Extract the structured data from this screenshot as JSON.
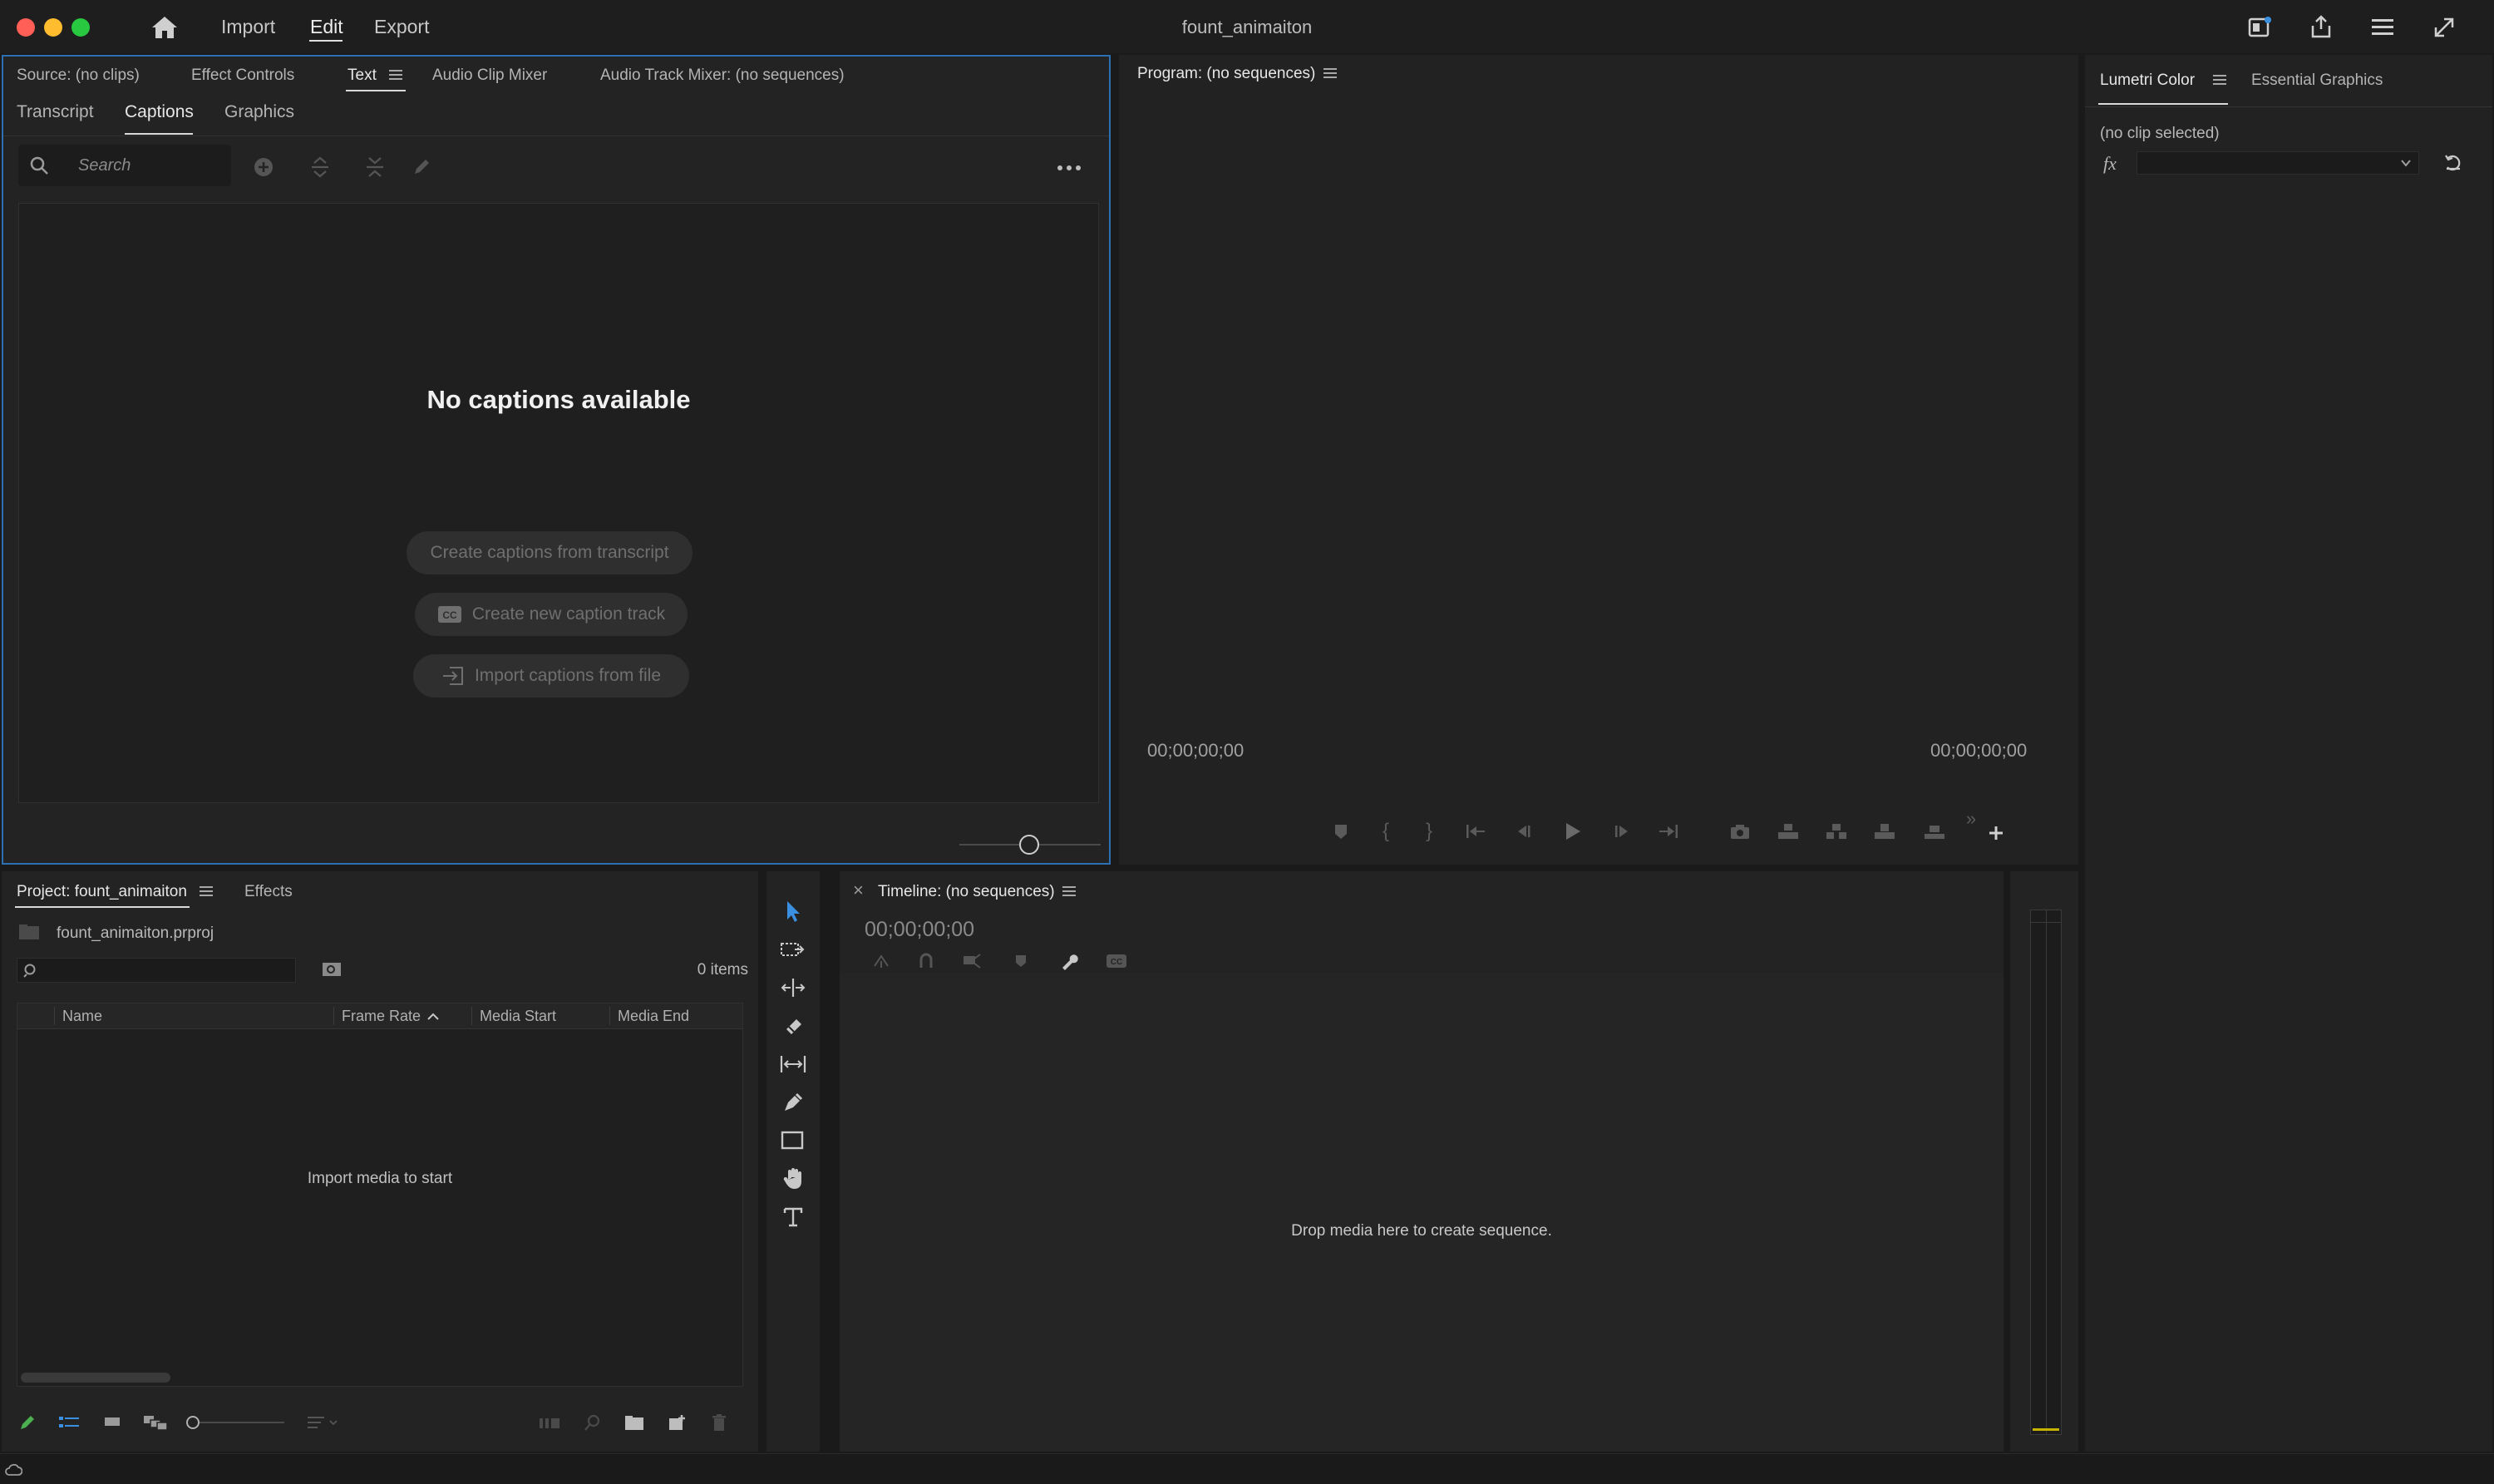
{
  "titlebar": {
    "title": "fount_animaiton",
    "nav": [
      "Import",
      "Edit",
      "Export"
    ],
    "active_nav": "Edit",
    "icons": [
      "home-icon",
      "quick-export-icon",
      "share-icon",
      "workspaces-icon",
      "fullscreen-icon"
    ]
  },
  "text_panel": {
    "top_tabs": [
      "Source: (no clips)",
      "Effect Controls",
      "Text",
      "Audio Clip Mixer",
      "Audio Track Mixer: (no sequences)"
    ],
    "active_top_tab": "Text",
    "sub_tabs": [
      "Transcript",
      "Captions",
      "Graphics"
    ],
    "active_sub_tab": "Captions",
    "search_placeholder": "Search",
    "empty_title": "No captions available",
    "buttons": [
      "Create captions from transcript",
      "Create new caption track",
      "Import captions from file"
    ]
  },
  "program_monitor": {
    "title": "Program: (no sequences)",
    "timecode_left": "00;00;00;00",
    "timecode_right": "00;00;00;00",
    "controls": [
      "add-marker-icon",
      "mark-in-icon",
      "mark-out-icon",
      "go-to-in-icon",
      "step-back-icon",
      "play-icon",
      "step-forward-icon",
      "go-to-out-icon",
      "export-frame-icon",
      "lift-icon",
      "extract-icon",
      "insert-icon",
      "overwrite-icon",
      "more-icon",
      "add-button-icon"
    ]
  },
  "lumetri": {
    "tabs": [
      "Lumetri Color",
      "Essential Graphics"
    ],
    "active_tab": "Lumetri Color",
    "status": "(no clip selected)",
    "fx_label": "fx"
  },
  "project": {
    "tabs": [
      "Project: fount_animaiton",
      "Effects"
    ],
    "active_tab": "Project: fount_animaiton",
    "file": "fount_animaiton.prproj",
    "items_count": "0 items",
    "columns": [
      "Name",
      "Frame Rate",
      "Media Start",
      "Media End"
    ],
    "empty_text": "Import media to start"
  },
  "timeline": {
    "title": "Timeline: (no sequences)",
    "close_glyph": "×",
    "timecode": "00;00;00;00",
    "empty_text": "Drop media here to create sequence."
  },
  "tools": [
    "selection-tool-icon",
    "track-select-tool-icon",
    "ripple-edit-tool-icon",
    "razor-tool-icon",
    "slip-tool-icon",
    "pen-tool-icon",
    "rectangle-tool-icon",
    "hand-tool-icon",
    "type-tool-icon"
  ],
  "colors": {
    "background": "#1a1a1a",
    "panel": "#232323",
    "focus_border": "#2d6fb3",
    "selection_tool": "#3b8fe0",
    "meter_yellow": "#c8b400"
  }
}
